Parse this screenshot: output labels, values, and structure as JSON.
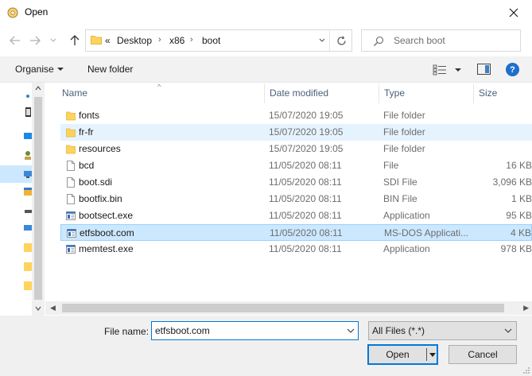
{
  "window": {
    "title": "Open",
    "close_icon": "close-icon",
    "app_icon": "dialog-app-icon"
  },
  "nav": {
    "back_icon": "arrow-left-icon",
    "forward_icon": "arrow-right-icon",
    "recent_icon": "chevron-down-icon",
    "up_icon": "arrow-up-icon"
  },
  "address": {
    "overflow": "«",
    "crumbs": [
      "Desktop",
      "x86",
      "boot"
    ],
    "separator": "›",
    "refresh_icon": "refresh-icon"
  },
  "search": {
    "placeholder": "Search boot",
    "icon": "search-icon"
  },
  "toolbar": {
    "organise": "Organise",
    "new_folder": "New folder",
    "help": "?"
  },
  "columns": {
    "name": "Name",
    "date": "Date modified",
    "type": "Type",
    "size": "Size"
  },
  "files": [
    {
      "name": "fonts",
      "date": "15/07/2020 19:05",
      "type": "File folder",
      "size": "",
      "icon": "folder-icon",
      "state": ""
    },
    {
      "name": "fr-fr",
      "date": "15/07/2020 19:05",
      "type": "File folder",
      "size": "",
      "icon": "folder-icon",
      "state": "hover"
    },
    {
      "name": "resources",
      "date": "15/07/2020 19:05",
      "type": "File folder",
      "size": "",
      "icon": "folder-icon",
      "state": ""
    },
    {
      "name": "bcd",
      "date": "11/05/2020 08:11",
      "type": "File",
      "size": "16 KB",
      "icon": "file-icon",
      "state": ""
    },
    {
      "name": "boot.sdi",
      "date": "11/05/2020 08:11",
      "type": "SDI File",
      "size": "3,096 KB",
      "icon": "file-icon",
      "state": ""
    },
    {
      "name": "bootfix.bin",
      "date": "11/05/2020 08:11",
      "type": "BIN File",
      "size": "1 KB",
      "icon": "file-icon",
      "state": ""
    },
    {
      "name": "bootsect.exe",
      "date": "11/05/2020 08:11",
      "type": "Application",
      "size": "95 KB",
      "icon": "application-icon",
      "state": ""
    },
    {
      "name": "etfsboot.com",
      "date": "11/05/2020 08:11",
      "type": "MS-DOS Applicati...",
      "size": "4 KB",
      "icon": "application-icon",
      "state": "selected"
    },
    {
      "name": "memtest.exe",
      "date": "11/05/2020 08:11",
      "type": "Application",
      "size": "978 KB",
      "icon": "application-icon",
      "state": ""
    }
  ],
  "bottom": {
    "file_name_label": "File name:",
    "file_name_value": "etfsboot.com",
    "filter_value": "All Files (*.*)",
    "open_label": "Open",
    "cancel_label": "Cancel"
  },
  "colors": {
    "accent": "#0078d7",
    "selected_bg": "#cce8ff",
    "hover_bg": "#e5f3ff",
    "folder": "#ffd35c"
  }
}
